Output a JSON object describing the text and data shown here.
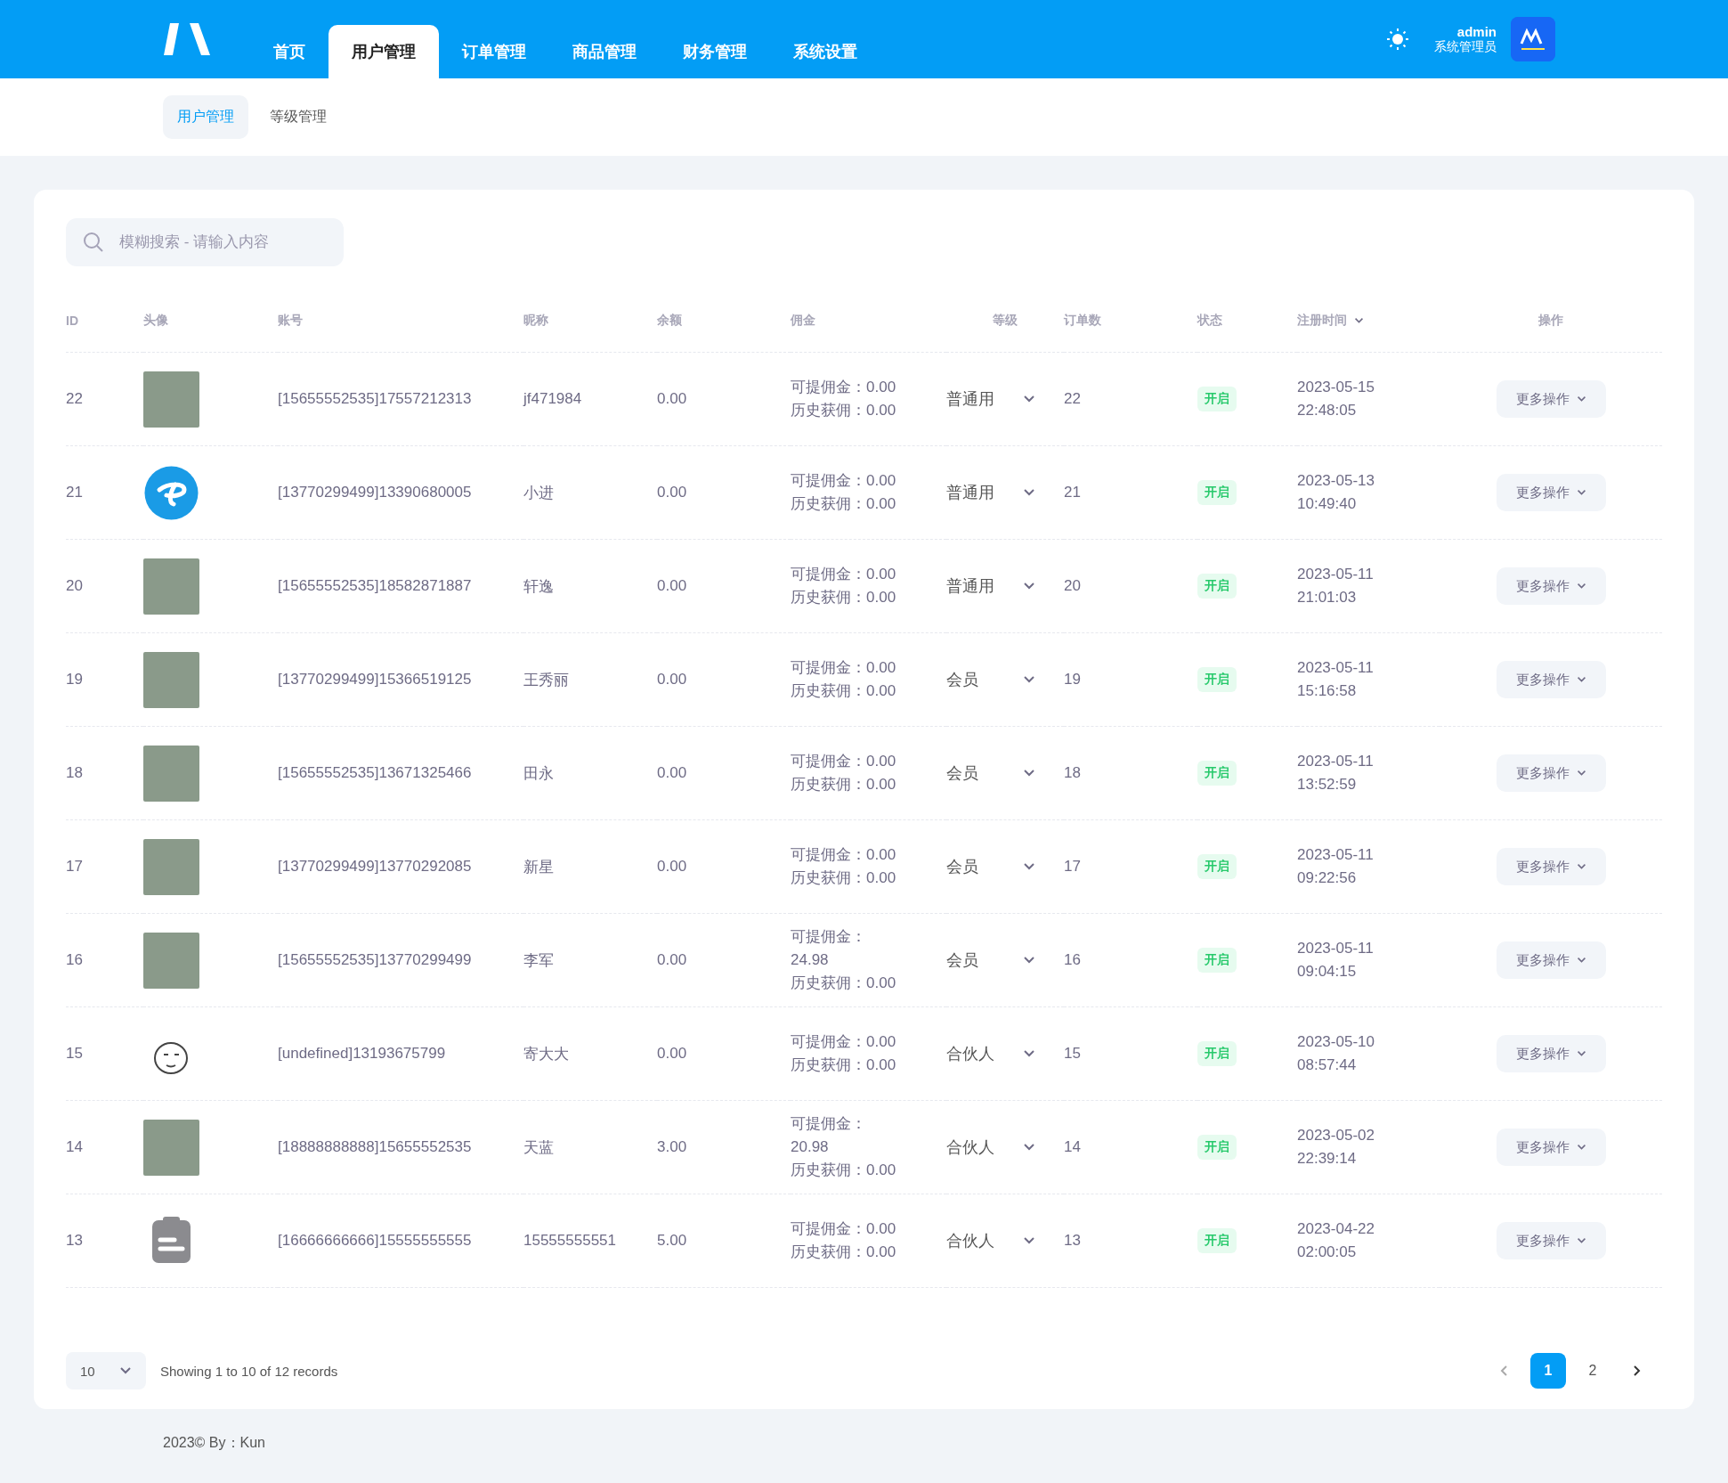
{
  "nav": {
    "tabs": [
      {
        "label": "首页",
        "selected": false
      },
      {
        "label": "用户管理",
        "selected": true
      },
      {
        "label": "订单管理",
        "selected": false
      },
      {
        "label": "商品管理",
        "selected": false
      },
      {
        "label": "财务管理",
        "selected": false
      },
      {
        "label": "系统设置",
        "selected": false
      }
    ],
    "user": {
      "name": "admin",
      "role": "系统管理员"
    }
  },
  "subnav": [
    {
      "label": "用户管理",
      "selected": true
    },
    {
      "label": "等级管理",
      "selected": false
    }
  ],
  "search": {
    "placeholder": "模糊搜索 - 请输入内容"
  },
  "table": {
    "columns": [
      "ID",
      "头像",
      "账号",
      "昵称",
      "余额",
      "佣金",
      "等级",
      "订单数",
      "状态",
      "注册时间",
      "操作"
    ],
    "rows": [
      {
        "id": "22",
        "avatar": {
          "kind": "photo"
        },
        "account": "[15655552535]17557212313",
        "nickname": "jf471984",
        "balance": "0.00",
        "commission": [
          "可提佣金：0.00",
          "历史获佣：0.00"
        ],
        "level": "普通用",
        "orders": "22",
        "status": "开启",
        "date": "2023-05-15",
        "time": "22:48:05",
        "action": "更多操作"
      },
      {
        "id": "21",
        "avatar": {
          "kind": "logo"
        },
        "account": "[13770299499]13390680005",
        "nickname": "小进",
        "balance": "0.00",
        "commission": [
          "可提佣金：0.00",
          "历史获佣：0.00"
        ],
        "level": "普通用",
        "orders": "21",
        "status": "开启",
        "date": "2023-05-13",
        "time": "10:49:40",
        "action": "更多操作"
      },
      {
        "id": "20",
        "avatar": {
          "kind": "photo"
        },
        "account": "[15655552535]18582871887",
        "nickname": "轩逸",
        "balance": "0.00",
        "commission": [
          "可提佣金：0.00",
          "历史获佣：0.00"
        ],
        "level": "普通用",
        "orders": "20",
        "status": "开启",
        "date": "2023-05-11",
        "time": "21:01:03",
        "action": "更多操作"
      },
      {
        "id": "19",
        "avatar": {
          "kind": "photo"
        },
        "account": "[13770299499]15366519125",
        "nickname": "王秀丽",
        "balance": "0.00",
        "commission": [
          "可提佣金：0.00",
          "历史获佣：0.00"
        ],
        "level": "会员",
        "orders": "19",
        "status": "开启",
        "date": "2023-05-11",
        "time": "15:16:58",
        "action": "更多操作"
      },
      {
        "id": "18",
        "avatar": {
          "kind": "photo"
        },
        "account": "[15655552535]13671325466",
        "nickname": "田永",
        "balance": "0.00",
        "commission": [
          "可提佣金：0.00",
          "历史获佣：0.00"
        ],
        "level": "会员",
        "orders": "18",
        "status": "开启",
        "date": "2023-05-11",
        "time": "13:52:59",
        "action": "更多操作"
      },
      {
        "id": "17",
        "avatar": {
          "kind": "photo"
        },
        "account": "[13770299499]13770292085",
        "nickname": "新星",
        "balance": "0.00",
        "commission": [
          "可提佣金：0.00",
          "历史获佣：0.00"
        ],
        "level": "会员",
        "orders": "17",
        "status": "开启",
        "date": "2023-05-11",
        "time": "09:22:56",
        "action": "更多操作"
      },
      {
        "id": "16",
        "avatar": {
          "kind": "photo"
        },
        "account": "[15655552535]13770299499",
        "nickname": "李军",
        "balance": "0.00",
        "commission": [
          "可提佣金：24.98",
          "历史获佣：0.00"
        ],
        "level": "会员",
        "orders": "16",
        "status": "开启",
        "date": "2023-05-11",
        "time": "09:04:15",
        "action": "更多操作"
      },
      {
        "id": "15",
        "avatar": {
          "kind": "sticker"
        },
        "account": "[undefined]13193675799",
        "nickname": "寄大大",
        "balance": "0.00",
        "commission": [
          "可提佣金：0.00",
          "历史获佣：0.00"
        ],
        "level": "合伙人",
        "orders": "15",
        "status": "开启",
        "date": "2023-05-10",
        "time": "08:57:44",
        "action": "更多操作"
      },
      {
        "id": "14",
        "avatar": {
          "kind": "photo"
        },
        "account": "[18888888888]15655552535",
        "nickname": "天蓝",
        "balance": "3.00",
        "commission": [
          "可提佣金：20.98",
          "历史获佣：0.00"
        ],
        "level": "合伙人",
        "orders": "14",
        "status": "开启",
        "date": "2023-05-02",
        "time": "22:39:14",
        "action": "更多操作"
      },
      {
        "id": "13",
        "avatar": {
          "kind": "file"
        },
        "account": "[16666666666]15555555555",
        "nickname": "15555555551",
        "balance": "5.00",
        "commission": [
          "可提佣金：0.00",
          "历史获佣：0.00"
        ],
        "level": "合伙人",
        "orders": "13",
        "status": "开启",
        "date": "2023-04-22",
        "time": "02:00:05",
        "action": "更多操作"
      }
    ]
  },
  "pagination": {
    "page_size": "10",
    "info": "Showing 1 to 10 of 12 records",
    "pages": [
      {
        "label": "1",
        "selected": true
      },
      {
        "label": "2",
        "selected": false
      }
    ]
  },
  "footer": "2023© By：Kun"
}
